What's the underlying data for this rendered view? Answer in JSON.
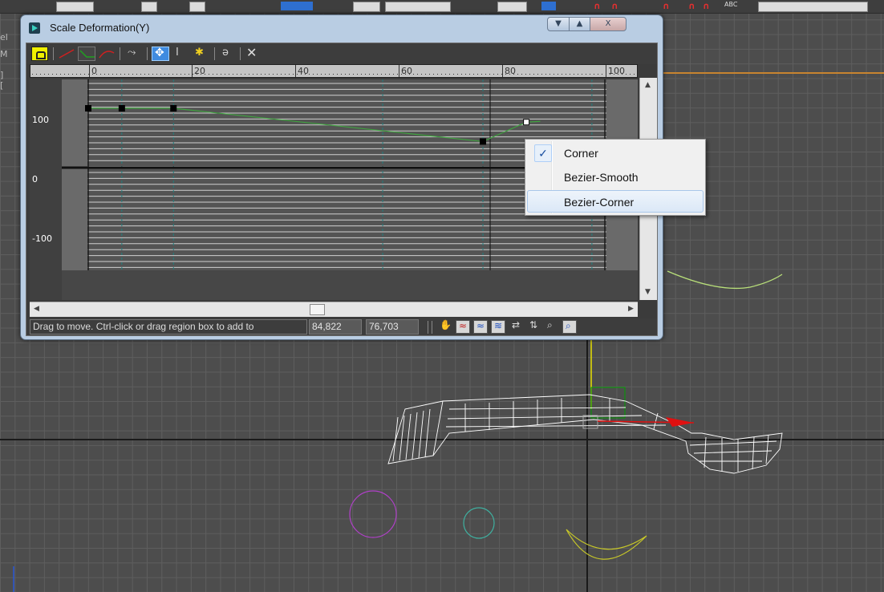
{
  "dialog": {
    "title": "Scale Deformation(Y)",
    "window_buttons": {
      "minimize": "▼",
      "maximize": "▲",
      "close": "X"
    }
  },
  "toolbar": {
    "icons": [
      "lock-icon",
      "linear-curve-icon",
      "curve-green-icon",
      "curve-red-icon",
      "swap-curve-icon",
      "move-control-point-icon",
      "scale-control-point-icon",
      "insert-point-icon",
      "reset-curve-icon",
      "delete-icon"
    ]
  },
  "ruler": {
    "labels": [
      "0",
      "20",
      "40",
      "60",
      "80",
      "100"
    ]
  },
  "graph": {
    "y_labels": [
      "100",
      "0",
      "-100"
    ],
    "curve_points": [
      {
        "frame": 0,
        "value": 100
      },
      {
        "frame": 6.5,
        "value": 100
      },
      {
        "frame": 16.5,
        "value": 100
      },
      {
        "frame": 76.4,
        "value": 44
      },
      {
        "frame": 84.8,
        "value": 76.7
      }
    ],
    "colors": {
      "curve": "#3fa33f",
      "grid": "#d0d0d0",
      "zero_line": "#111111"
    }
  },
  "context_menu": {
    "items": [
      {
        "label": "Corner",
        "checked": true
      },
      {
        "label": "Bezier-Smooth",
        "checked": false
      },
      {
        "label": "Bezier-Corner",
        "checked": false,
        "highlighted": true
      }
    ],
    "check_mark": "✓"
  },
  "status_bar": {
    "hint": "Drag to move. Ctrl-click or drag region box to add to",
    "coord_x": "84,822",
    "coord_y": "76,703",
    "icons": [
      "pan-icon",
      "zoom-extents-icon",
      "zoom-horizontal-extents-icon",
      "zoom-value-extents-icon",
      "zoom-horizontal-icon",
      "zoom-vertical-icon",
      "zoom-icon",
      "zoom-region-icon"
    ]
  },
  "viewport": {
    "top_toolbar_abc": "ABC",
    "left_strip_chars": [
      "el",
      "M",
      "] ["
    ]
  }
}
